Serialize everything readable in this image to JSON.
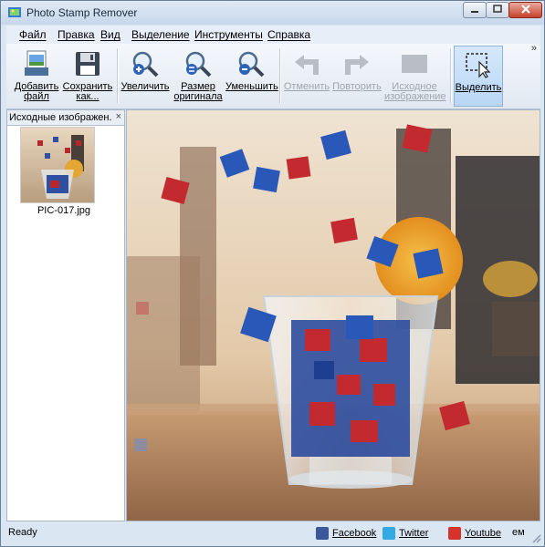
{
  "window": {
    "title": "Photo Stamp Remover"
  },
  "menu": [
    "Файл",
    "Правка",
    "Вид",
    "Выделение",
    "Инструменты",
    "Справка"
  ],
  "toolbar": {
    "add_file": [
      "Добавить",
      "файл"
    ],
    "save_as": [
      "Сохранить",
      "как..."
    ],
    "zoom_in": [
      "Увеличить"
    ],
    "original_size": [
      "Размер",
      "оригинала"
    ],
    "zoom_out": [
      "Уменьшить"
    ],
    "undo": [
      "Отменить"
    ],
    "redo": [
      "Повторить"
    ],
    "source_image": [
      "Исходное",
      "изображение"
    ],
    "select": [
      "Выделить"
    ],
    "overflow": "»"
  },
  "left_panel": {
    "tab_title": "Исходные изображен...",
    "close": "×",
    "files": [
      {
        "name": "PIC-017.jpg"
      }
    ]
  },
  "status": {
    "text": "Ready",
    "facebook": "Facebook",
    "twitter": "Twitter",
    "youtube": "Youtube",
    "extra": "ем"
  },
  "colors": {
    "frame": "#dbe6f3",
    "close_button": "#c7422b",
    "active_tool": "#b9d6f4",
    "dice_red": "#c4262e",
    "dice_blue": "#1f4aa8"
  }
}
